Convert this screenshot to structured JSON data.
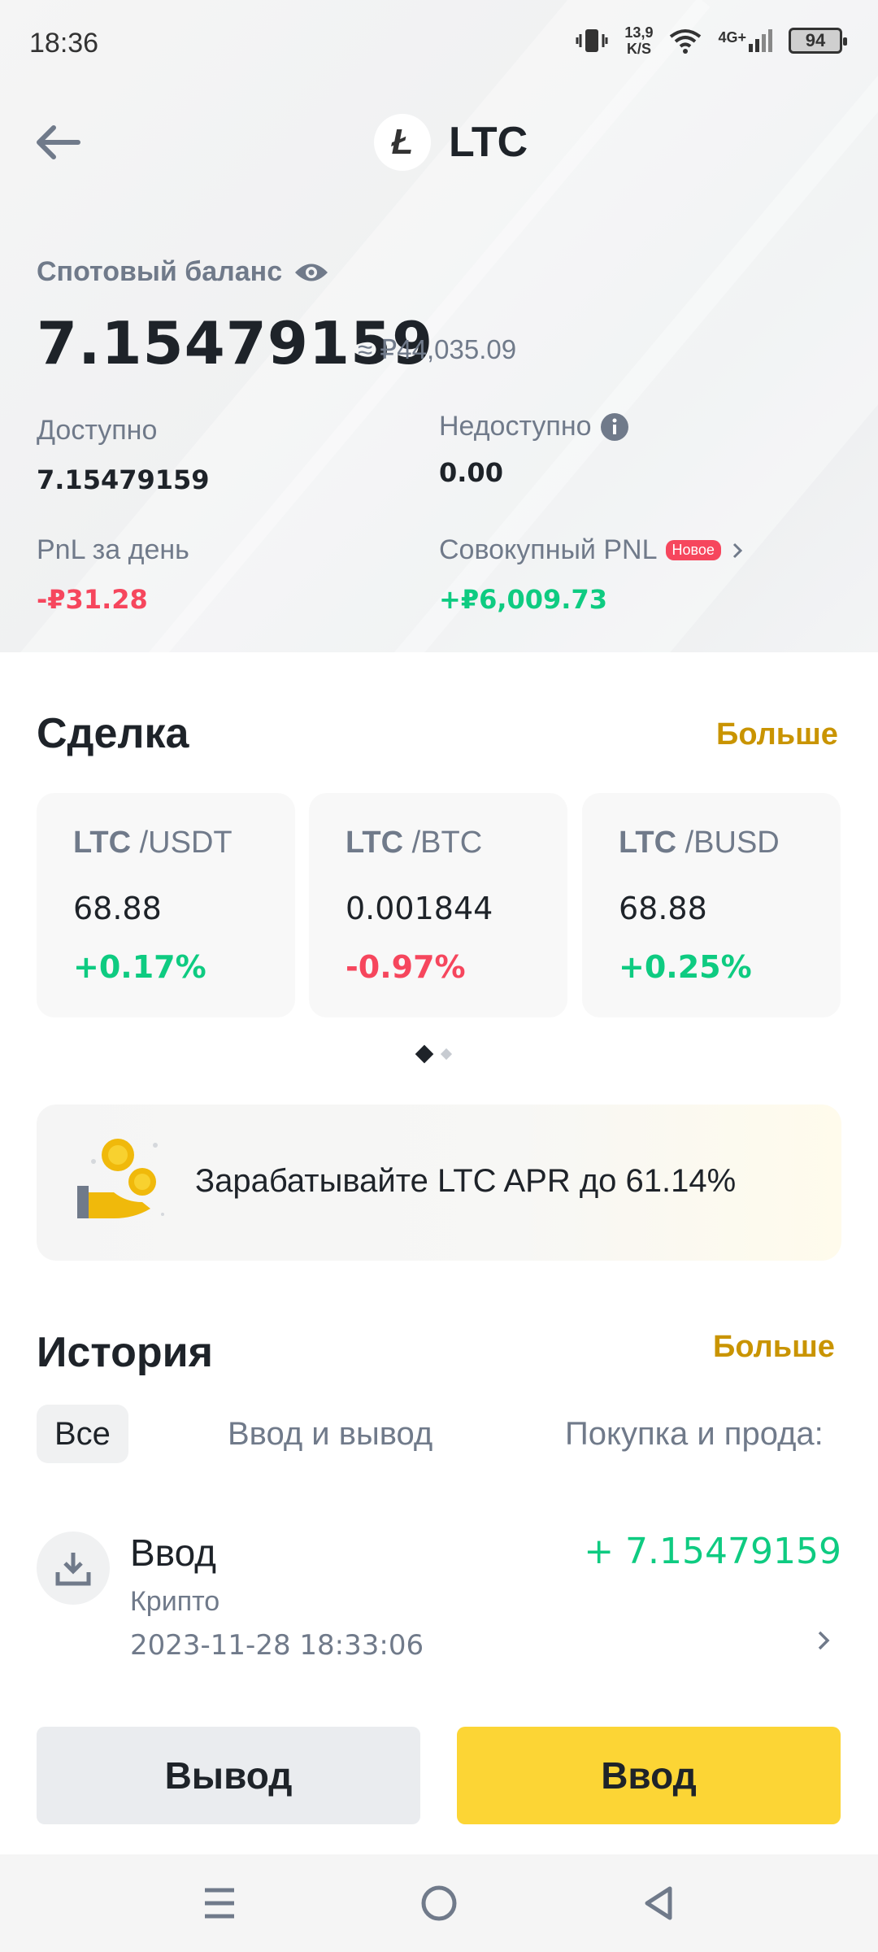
{
  "status_bar": {
    "time": "18:36",
    "net_speed_value": "13,9",
    "net_speed_unit": "K/S",
    "network": "4G+",
    "battery": "94"
  },
  "header": {
    "title": "LTC",
    "coin_logo_letter": "Ł"
  },
  "balance": {
    "label": "Спотовый баланс",
    "value": "7.15479159",
    "fiat": "≈ ₽44,035.09"
  },
  "stats": {
    "available_label": "Доступно",
    "available_value": "7.15479159",
    "unavailable_label": "Недоступно",
    "unavailable_value": "0.00",
    "pnl_day_label": "PnL за день",
    "pnl_day_value": "-₽31.28",
    "pnl_total_label": "Совокупный PNL",
    "pnl_total_badge": "Новое",
    "pnl_total_value": "+₽6,009.73"
  },
  "trade": {
    "title": "Сделка",
    "more": "Больше",
    "pairs": [
      {
        "base": "LTC",
        "quote": "/USDT",
        "price": "68.88",
        "change": "+0.17%"
      },
      {
        "base": "LTC",
        "quote": "/BTC",
        "price": "0.001844",
        "change": "-0.97%"
      },
      {
        "base": "LTC",
        "quote": "/BUSD",
        "price": "68.88",
        "change": "+0.25%"
      }
    ]
  },
  "earn": {
    "text": "Зарабатывайте LTC APR до 61.14%"
  },
  "history": {
    "title": "История",
    "more": "Больше",
    "tabs": [
      "Все",
      "Ввод и вывод",
      "Покупка и прода:"
    ],
    "items": [
      {
        "type": "Ввод",
        "sub": "Крипто",
        "date": "2023-11-28 18:33:06",
        "amount": "+ 7.15479159"
      }
    ]
  },
  "actions": {
    "withdraw": "Вывод",
    "deposit": "Ввод"
  },
  "colors": {
    "accent": "#fcd535",
    "link": "#c99400",
    "positive": "#0ecb81",
    "negative": "#f6465d"
  }
}
